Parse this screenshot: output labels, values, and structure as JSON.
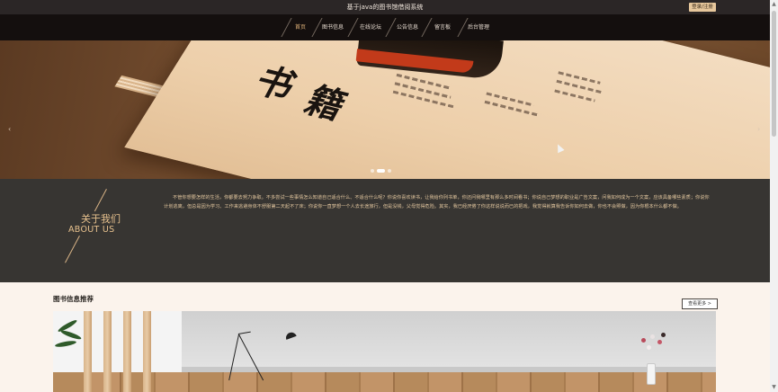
{
  "site": {
    "title": "基于java的图书馆借阅系统",
    "login_label": "登录/注册"
  },
  "nav": {
    "items": [
      {
        "label": "首页",
        "active": true
      },
      {
        "label": "图书信息",
        "active": false
      },
      {
        "label": "在线论坛",
        "active": false
      },
      {
        "label": "公告信息",
        "active": false
      },
      {
        "label": "留言板",
        "active": false
      },
      {
        "label": "后台管理",
        "active": false
      }
    ]
  },
  "carousel": {
    "prev_icon": "‹",
    "next_icon": "›",
    "slide_count": 3,
    "active_slide": 2
  },
  "about": {
    "title": "关于我们",
    "subtitle": "ABOUT US",
    "text": "不管你想要怎样的生活，你都要去努力争取。不多尝试一些事情怎么知道自己适合什么、不适合什么呢？你说你喜欢读书，让我给你列书单，你还问我哪里有那么多时间看书；你说自己梦想的职业是广告文案，问我如何成为一个文案，应该具备哪些素质；你说你计划逃离，但总是因为学习、工作来逃避身体不舒服第二天起不了床；你说你一直梦想一个人去长途旅行，但是没钱，父母觉得危险。其实，我已经厌倦了你这样说说而已的把戏，我觉得就算我告诉你如何去做，你也不会照做，因为你根本什么都不做。"
  },
  "books": {
    "section_title": "图书信息推荐",
    "more_label": "查看更多 >"
  },
  "colors": {
    "accent": "#e0b37a",
    "topbar": "#2b2626",
    "nav": "#140f0e",
    "about_bg": "#373532",
    "page_bg": "#fbf3ec"
  }
}
